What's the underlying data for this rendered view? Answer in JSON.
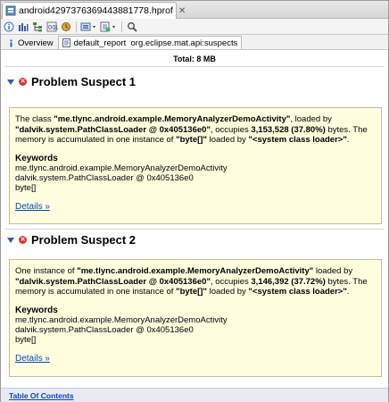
{
  "editor_tab": {
    "title": "android4297376369443881778.hprof"
  },
  "toolbar": {
    "icons": [
      "info-icon",
      "histogram-icon",
      "dominator-tree-icon",
      "query-browser-icon",
      "run-report-icon",
      "search-icon"
    ]
  },
  "subtabs": [
    {
      "label": "Overview"
    },
    {
      "label": "default_report  org.eclipse.mat.api:suspects"
    }
  ],
  "total": "Total: 8 MB",
  "suspects": [
    {
      "title": "Problem Suspect 1",
      "text_1": "The class ",
      "class_name": "\"me.tlync.android.example.MemoryAnalyzerDemoActivity\"",
      "text_2": ", loaded by ",
      "loader": "\"dalvik.system.PathClassLoader @ 0x405136e0\"",
      "text_3": ", occupies ",
      "size": "3,153,528 (37.80%)",
      "text_4": " bytes. The memory is accumulated in one instance of ",
      "type": "\"byte[]\"",
      "text_5": " loaded by ",
      "system_loader": "\"<system class loader>\"",
      "text_6": ".",
      "keywords_title": "Keywords",
      "keywords": [
        "me.tlync.android.example.MemoryAnalyzerDemoActivity",
        "dalvik.system.PathClassLoader @ 0x405136e0",
        "byte[]"
      ],
      "details": "Details »"
    },
    {
      "title": "Problem Suspect 2",
      "text_1": "One instance of ",
      "class_name": "\"me.tlync.android.example.MemoryAnalyzerDemoActivity\"",
      "text_2": " loaded by ",
      "loader": "\"dalvik.system.PathClassLoader @ 0x405136e0\"",
      "text_3": ", occupies ",
      "size": "3,146,392 (37.72%)",
      "text_4": " bytes. The memory is accumulated in one instance of ",
      "type": "\"byte[]\"",
      "text_5": " loaded by ",
      "system_loader": "\"<system class loader>\"",
      "text_6": ".",
      "keywords_title": "Keywords",
      "keywords": [
        "me.tlync.android.example.MemoryAnalyzerDemoActivity",
        "dalvik.system.PathClassLoader @ 0x405136e0",
        "byte[]"
      ],
      "details": "Details »"
    }
  ],
  "footer": {
    "toc": "Table Of Contents"
  }
}
